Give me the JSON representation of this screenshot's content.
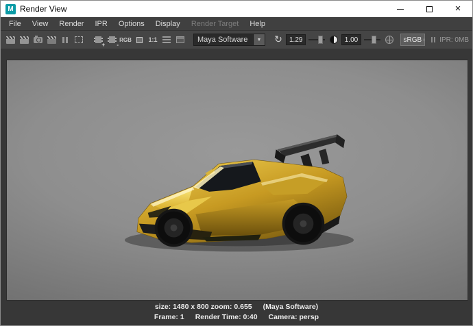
{
  "window": {
    "title": "Render View",
    "app_icon": "M"
  },
  "menubar": {
    "items": [
      {
        "label": "File",
        "enabled": true
      },
      {
        "label": "View",
        "enabled": true
      },
      {
        "label": "Render",
        "enabled": true
      },
      {
        "label": "IPR",
        "enabled": true
      },
      {
        "label": "Options",
        "enabled": true
      },
      {
        "label": "Display",
        "enabled": true
      },
      {
        "label": "Render Target",
        "enabled": false
      },
      {
        "label": "Help",
        "enabled": true
      }
    ]
  },
  "toolbar": {
    "rgb_label": "RGB",
    "ratio_label": "1:1",
    "renderer_selected": "Maya Software",
    "exposure_value": "1.29",
    "contrast_value": "1.00",
    "colorspace_label": "sRGB gamm",
    "ipr_memory_label": "IPR: 0MB"
  },
  "statusbar": {
    "size_zoom": "size: 1480 x 800 zoom: 0.655",
    "renderer_note": "(Maya Software)",
    "frame": "Frame: 1",
    "render_time": "Render Time: 0:40",
    "camera": "Camera: persp"
  },
  "colors": {
    "car_body": "#d4a82c",
    "car_wing": "#2d2d2d",
    "viewport_top": "#999999",
    "viewport_bottom": "#5c5c5c"
  }
}
